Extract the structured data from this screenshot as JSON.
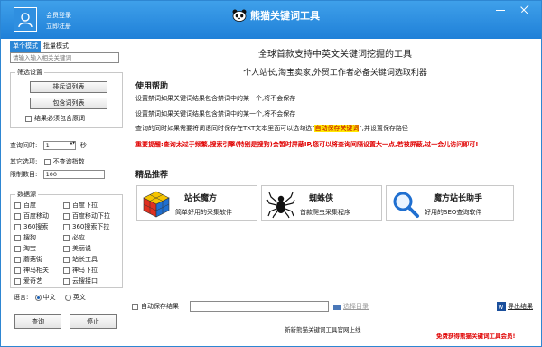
{
  "titlebar": {
    "login": "会员登录",
    "register": "立即注册",
    "app_name": "熊猫关键词工具"
  },
  "left": {
    "tabs": [
      "单个模式",
      "批量模式"
    ],
    "keyword_placeholder": "请输入输入相关关键词",
    "filter": {
      "title": "筛选设置",
      "exclude_btn": "排斥词列表",
      "include_btn": "包含词列表",
      "must_include": "结果必须包含原词"
    },
    "query_interval_label": "查询间时:",
    "query_interval_value": "1",
    "query_interval_unit": "秒",
    "other_options_label": "其它选项:",
    "no_index_label": "不查询指数",
    "limit_label": "限制数目:",
    "limit_value": "100",
    "sources": {
      "title": "数据源",
      "items": [
        [
          "百度",
          "百度下拉"
        ],
        [
          "百度移动",
          "百度移动下拉"
        ],
        [
          "360搜索",
          "360搜索下拉"
        ],
        [
          "搜狗",
          "必应"
        ],
        [
          "淘宝",
          "美丽说"
        ],
        [
          "蘑菇街",
          "站长工具"
        ],
        [
          "神马相关",
          "神马下拉"
        ],
        [
          "爱奇艺",
          "云搜接口"
        ]
      ]
    },
    "language_label": "语言:",
    "lang_cn": "中文",
    "lang_en": "英文",
    "query_btn": "查询",
    "stop_btn": "停止"
  },
  "main": {
    "headline": "全球首款支持中英文关键词挖掘的工具",
    "subline": "个人站长,淘宝卖家,外贸工作者必备关键词选取利器",
    "help_title": "使用帮助",
    "help_1": "设置禁词如果关键词结果包含禁词中的某一个,将不会保存",
    "help_2": "设置禁词如果关键词结果包含禁词中的某一个,将不会保存",
    "help_3a": "查询的同时如果需要将词语同时保存在TXT文本里面可以选勾选\"",
    "help_3b": "自动保存关键词",
    "help_3c": "\",并设置保存路径",
    "warning": "重要提醒:查询太过于频繁,搜索引擎(特别是搜狗)会暂时屏蔽IP,您可以将查询间隔设置大一点,若被屏蔽,过一会儿访问即可!",
    "recommend_title": "精品推荐",
    "cards": [
      {
        "title": "站长魔方",
        "desc": "简单好用的采集软件"
      },
      {
        "title": "蜘蛛侠",
        "desc": "首款爬虫采集程序"
      },
      {
        "title": "魔方站长助手",
        "desc": "好用的SEO查询软件"
      }
    ],
    "autosave_label": "自动保存结果",
    "choose_dir": "选择目录",
    "export_label": "导出结果",
    "footer_link": "新新熊猫关键词工具官网上线",
    "footer_red": "免费获得熊猫关键词工具会员!"
  }
}
